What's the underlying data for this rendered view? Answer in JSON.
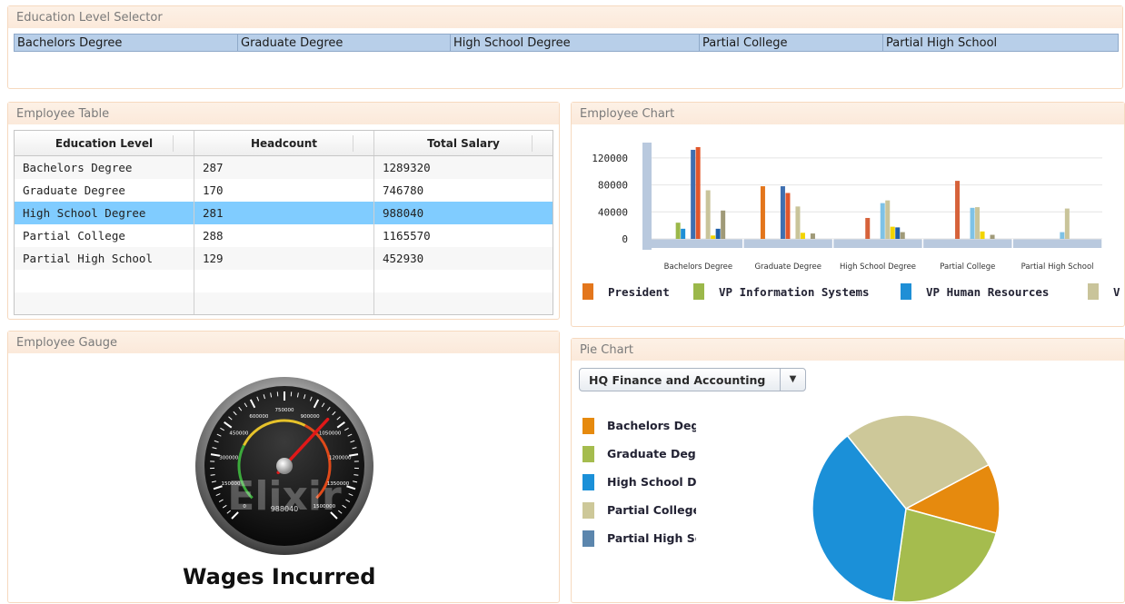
{
  "selector": {
    "title": "Education Level Selector",
    "items": [
      "Bachelors Degree",
      "Graduate Degree",
      "High School Degree",
      "Partial College",
      "Partial High School"
    ]
  },
  "table": {
    "title": "Employee Table",
    "headers": [
      "Education Level",
      "Headcount",
      "Total Salary"
    ],
    "rows": [
      [
        "Bachelors Degree",
        "287",
        "1289320"
      ],
      [
        "Graduate Degree",
        "170",
        "746780"
      ],
      [
        "High School Degree",
        "281",
        "988040"
      ],
      [
        "Partial College",
        "288",
        "1165570"
      ],
      [
        "Partial High School",
        "129",
        "452930"
      ]
    ],
    "selected_row": 2
  },
  "chart": {
    "title": "Employee Chart",
    "legend": [
      "President",
      "VP Information Systems",
      "VP Human Resources",
      "V"
    ]
  },
  "chart_data": {
    "type": "bar",
    "categories": [
      "Bachelors Degree",
      "Graduate Degree",
      "High School Degree",
      "Partial College",
      "Partial High School"
    ],
    "ylim": [
      0,
      140000
    ],
    "yticks": [
      0,
      40000,
      80000,
      120000
    ],
    "series": [
      {
        "name": "President",
        "color": "#e3761c",
        "values": [
          0,
          78000,
          0,
          0,
          0
        ]
      },
      {
        "name": "VP Information Systems",
        "color": "#9bb84a",
        "values": [
          24000,
          0,
          0,
          0,
          0
        ]
      },
      {
        "name": "VP Human Resources",
        "color": "#1f8fd6",
        "values": [
          15000,
          0,
          0,
          0,
          0
        ]
      },
      {
        "name": "",
        "color": "#d6623a",
        "values": [
          0,
          0,
          31000,
          86000,
          0
        ]
      },
      {
        "name": "",
        "color": "#3e6fb0",
        "values": [
          132000,
          78000,
          0,
          0,
          0
        ]
      },
      {
        "name": "",
        "color": "#e1572b",
        "values": [
          136000,
          68000,
          0,
          0,
          0
        ]
      },
      {
        "name": "",
        "color": "#7ec2e6",
        "values": [
          0,
          0,
          53000,
          46000,
          10000
        ]
      },
      {
        "name": "",
        "color": "#c9c49a",
        "values": [
          72000,
          48000,
          57000,
          47000,
          45000
        ]
      },
      {
        "name": "",
        "color": "#f2d400",
        "values": [
          5000,
          9000,
          18000,
          11000,
          0
        ]
      },
      {
        "name": "",
        "color": "#1f5fa8",
        "values": [
          15000,
          0,
          17000,
          0,
          0
        ]
      },
      {
        "name": "",
        "color": "#a09a78",
        "values": [
          42000,
          8000,
          10000,
          6000,
          0
        ]
      }
    ]
  },
  "gauge": {
    "title": "Employee Gauge",
    "label": "Wages Incurred",
    "value": 988040,
    "value_text": "988040",
    "watermark": "Elixir",
    "tick_labels": [
      "0",
      "150000",
      "300000",
      "450000",
      "600000",
      "750000",
      "900000",
      "1050000",
      "1200000",
      "1350000",
      "1500000"
    ]
  },
  "pie": {
    "title": "Pie Chart",
    "dropdown_value": "HQ Finance and Accounting",
    "legend": [
      {
        "label": "Bachelors Degree",
        "color": "#e68a0e"
      },
      {
        "label": "Graduate Degree",
        "color": "#a5bc4e"
      },
      {
        "label": "High School Degree",
        "color": "#1b90d8"
      },
      {
        "label": "Partial College",
        "color": "#cdc899"
      },
      {
        "label": "Partial High School",
        "color": "#5c86ad"
      }
    ],
    "slices": [
      {
        "name": "Bachelors Degree",
        "value": 12
      },
      {
        "name": "Graduate Degree",
        "value": 23
      },
      {
        "name": "High School Degree",
        "value": 37
      },
      {
        "name": "Partial College",
        "value": 28
      },
      {
        "name": "Partial High School",
        "value": 0
      }
    ]
  },
  "colors": {
    "panel_border": "#f6d9bf",
    "selection": "#80ccff",
    "selector_bar": "#b8cfe9"
  }
}
